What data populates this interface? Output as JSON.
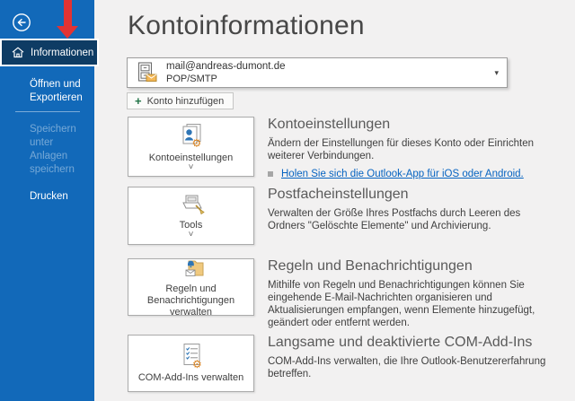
{
  "colors": {
    "sidebar_blue": "#1269b9",
    "selected_navy": "#0e3c64",
    "arrow_red": "#e23333",
    "link_blue": "#0563c1",
    "gear_orange": "#d9821e",
    "person_blue": "#2e75b5",
    "plus_green": "#217346",
    "background": "#f2f1f1"
  },
  "sidebar": {
    "items": [
      {
        "label": "Informationen",
        "state": "selected"
      },
      {
        "label": "Öffnen und Exportieren",
        "state": "normal"
      },
      {
        "label": "Speichern unter",
        "state": "disabled"
      },
      {
        "label": "Anlagen speichern",
        "state": "disabled"
      },
      {
        "label": "Drucken",
        "state": "normal"
      }
    ]
  },
  "main": {
    "title": "Kontoinformationen",
    "account_selector": {
      "email": "mail@andreas-dumont.de",
      "protocol": "POP/SMTP",
      "caret": "▾"
    },
    "add_account": {
      "plus": "+",
      "label": "Konto hinzufügen"
    },
    "sections": [
      {
        "button_label": "Kontoeinstellungen",
        "chevron": "˅",
        "heading": "Kontoeinstellungen",
        "body": "Ändern der Einstellungen für dieses Konto oder Einrichten weiterer Verbindungen.",
        "link": "Holen Sie sich die Outlook-App für iOS oder Android."
      },
      {
        "button_label": "Tools",
        "chevron": "˅",
        "heading": "Postfacheinstellungen",
        "body": "Verwalten der Größe Ihres Postfachs durch Leeren des Ordners \"Gelöschte Elemente\" und Archivierung."
      },
      {
        "button_label": "Regeln und Benachrichtigungen verwalten",
        "heading": "Regeln und Benachrichtigungen",
        "body": "Mithilfe von Regeln und Benachrichtigungen können Sie eingehende E-Mail-Nachrichten organisieren und Aktualisierungen empfangen, wenn Elemente hinzugefügt, geändert oder entfernt werden."
      },
      {
        "button_label": "COM-Add-Ins verwalten",
        "heading": "Langsame und deaktivierte COM-Add-Ins",
        "body": "COM-Add-Ins verwalten, die Ihre Outlook-Benutzererfahrung betreffen."
      }
    ]
  },
  "icons": {
    "back": "circled-left-arrow",
    "home": "house-outline",
    "account": "file-cabinet-with-envelope",
    "account_settings": "person-card-with-gear",
    "tools": "tray-with-broom",
    "rules": "folder-bell-envelope",
    "com_addins": "checklist-with-gear",
    "annotation": "red-down-arrow"
  }
}
